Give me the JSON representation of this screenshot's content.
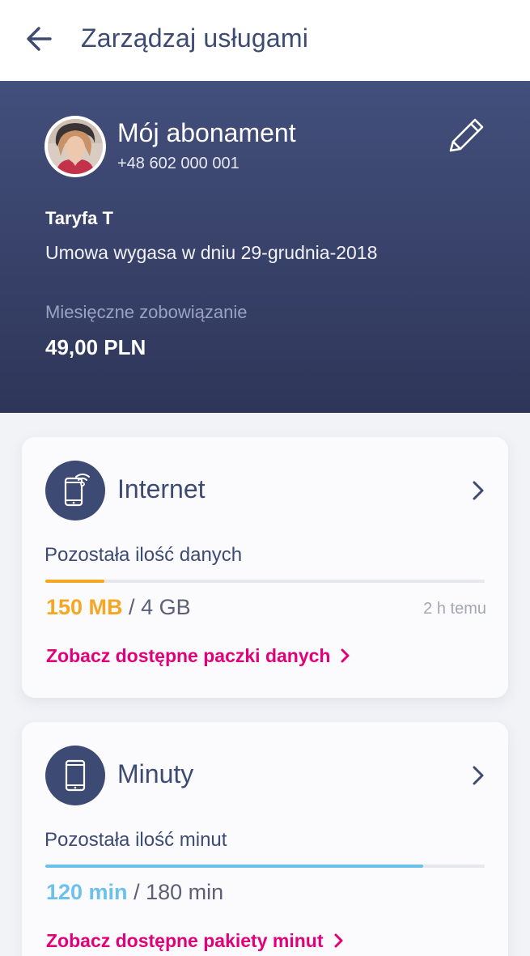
{
  "header": {
    "title": "Zarządzaj usługami"
  },
  "subscription": {
    "title": "Mój abonament",
    "phone": "+48 602 000 001",
    "tariff": "Taryfa T",
    "contract_text": "Umowa wygasa w dniu 29-grudnia-2018",
    "commitment_label": "Miesięczne zobowiązanie",
    "commitment_value": "49,00 PLN"
  },
  "internet": {
    "title": "Internet",
    "remaining_label": "Pozostała ilość danych",
    "used_amount": "150 MB",
    "separator": " / ",
    "total_amount": "4 GB",
    "progress_fraction": 0.135,
    "updated": "2 h temu",
    "link": "Zobacz dostępne paczki danych",
    "accent_color": "#f5a623"
  },
  "minutes": {
    "title": "Minuty",
    "remaining_label": "Pozostała ilość minut",
    "used_amount": "120 min",
    "separator": " / ",
    "total_amount": "180 min",
    "progress_fraction": 0.86,
    "link": "Zobacz dostępne pakiety minut",
    "accent_color": "#6cc1ec"
  },
  "colors": {
    "brand_magenta": "#e2007a",
    "navy": "#3d4a73"
  }
}
